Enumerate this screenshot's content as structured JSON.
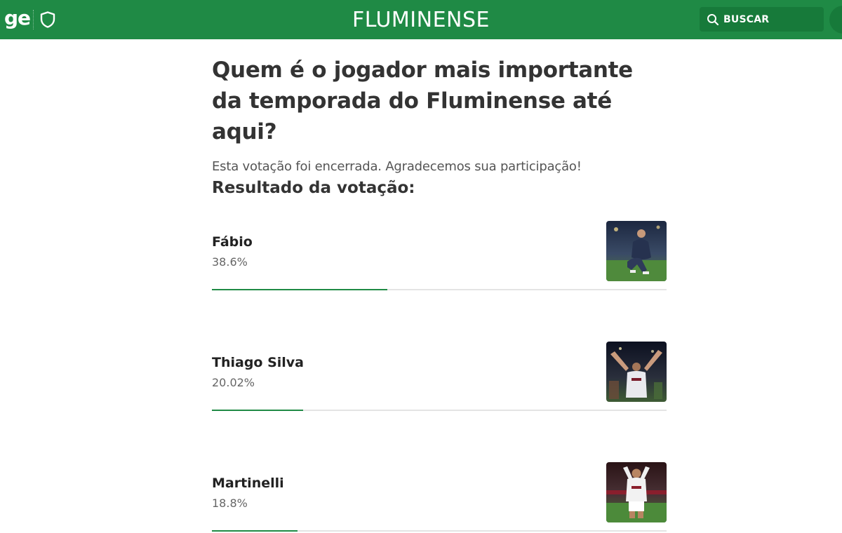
{
  "header": {
    "logo_text": "ge",
    "team_title": "FLUMINENSE",
    "search_label": "BUSCAR",
    "icons": [
      "shield-icon",
      "search-icon"
    ],
    "brand_color": "#1f8a45"
  },
  "poll": {
    "question": "Quem é o jogador mais importante da temporada do Fluminense até aqui?",
    "status": "Esta votação foi encerrada. Agradecemos sua participação!",
    "results_heading": "Resultado da votação:",
    "options": [
      {
        "name": "Fábio",
        "percent_label": "38.6%",
        "percent": 38.6
      },
      {
        "name": "Thiago Silva",
        "percent_label": "20.02%",
        "percent": 20.02
      },
      {
        "name": "Martinelli",
        "percent_label": "18.8%",
        "percent": 18.8
      }
    ]
  }
}
